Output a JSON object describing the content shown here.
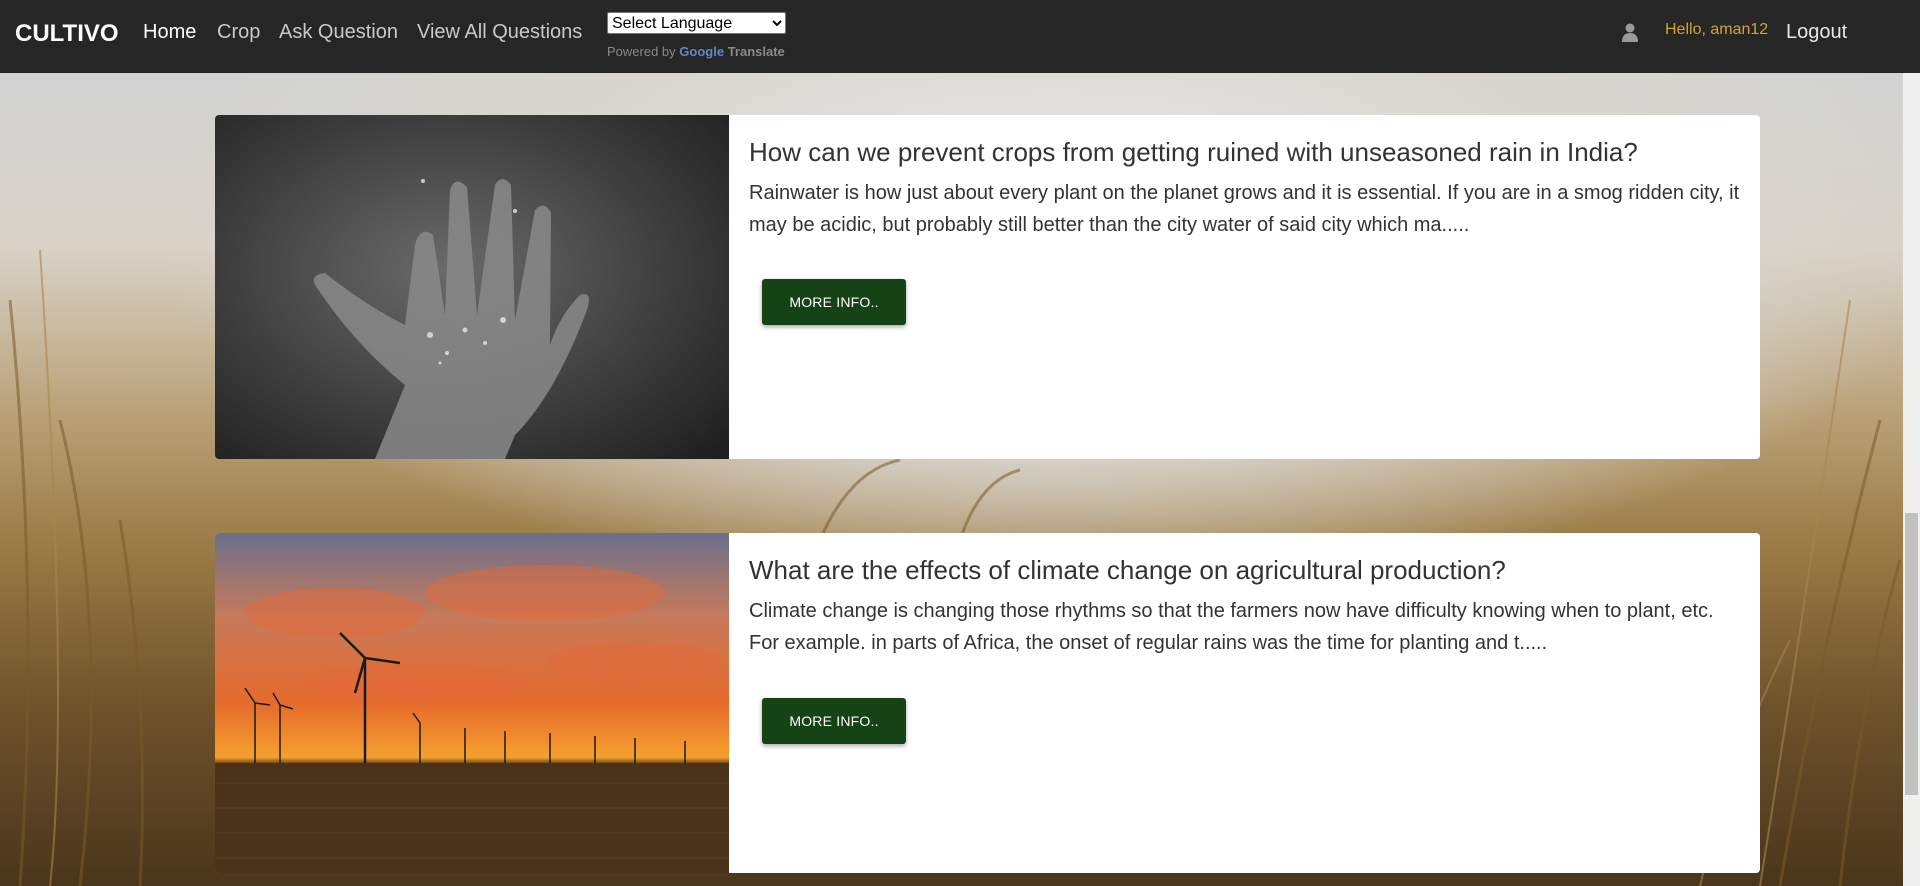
{
  "navbar": {
    "brand": "CULTIVO",
    "links": [
      "Home",
      "Crop",
      "Ask Question",
      "View All Questions"
    ],
    "language_select": "Select Language",
    "powered_by": "Powered by",
    "google": "Google",
    "translate": "Translate",
    "greeting": "Hello, aman12",
    "logout": "Logout"
  },
  "posts": [
    {
      "title": "How can we prevent crops from getting ruined with unseasoned rain in India?",
      "excerpt": "Rainwater is how just about every plant on the planet grows and it is essential. If you are in a smog ridden city, it may be acidic, but probably still better than the city water of said city which ma.....",
      "button": "MORE INFO.."
    },
    {
      "title": "What are the effects of climate change on agricultural production?",
      "excerpt": "Climate change is changing those rhythms so that the farmers now have difficulty knowing when to plant, etc. For example. in parts of Africa, the onset of regular rains was the time for planting and t.....",
      "button": "MORE INFO.."
    }
  ],
  "colors": {
    "navbar": "#262626",
    "greeting": "#d4a32a",
    "button": "#154316"
  }
}
